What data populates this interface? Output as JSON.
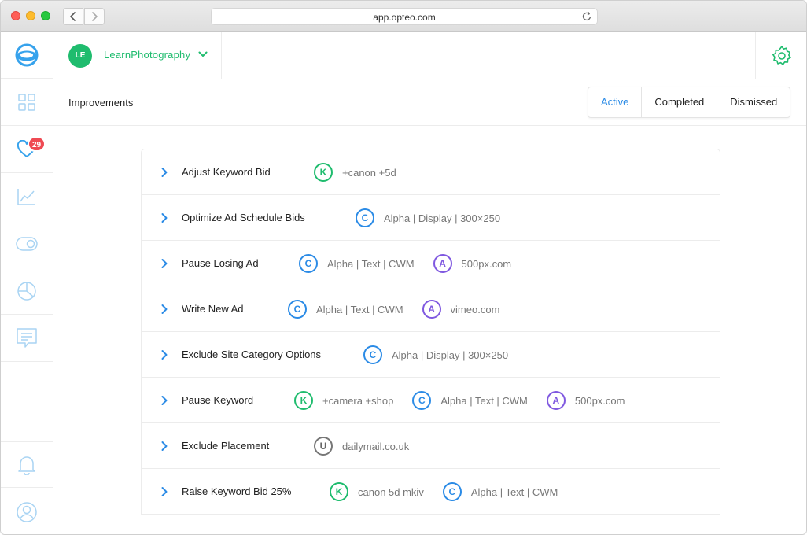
{
  "browser": {
    "url": "app.opteo.com",
    "icons": {
      "back": "chevron-left-icon",
      "forward": "chevron-right-icon",
      "reload": "reload-icon"
    }
  },
  "sidebar": {
    "items": [
      {
        "name": "logo",
        "icon": "opteo-logo-icon"
      },
      {
        "name": "dashboard",
        "icon": "grid-icon"
      },
      {
        "name": "improvements",
        "icon": "heart-icon",
        "badge": "29"
      },
      {
        "name": "performance",
        "icon": "line-chart-icon"
      },
      {
        "name": "toggles",
        "icon": "toggle-icon"
      },
      {
        "name": "reports",
        "icon": "pie-chart-icon"
      },
      {
        "name": "messages",
        "icon": "message-icon"
      }
    ],
    "bottom": [
      {
        "name": "notifications",
        "icon": "bell-icon"
      },
      {
        "name": "profile",
        "icon": "user-icon"
      }
    ]
  },
  "account": {
    "initials": "LE",
    "name": "LearnPhotography"
  },
  "page": {
    "title": "Improvements",
    "tabs": [
      {
        "label": "Active",
        "active": true
      },
      {
        "label": "Completed",
        "active": false
      },
      {
        "label": "Dismissed",
        "active": false
      }
    ]
  },
  "colors": {
    "green": "#1fbc6e",
    "blue": "#2b8be6",
    "purple": "#7f58e0",
    "gray": "#777777",
    "badge": "#ef4a53"
  },
  "improvements": [
    {
      "title": "Adjust Keyword Bid",
      "tags": [
        {
          "letter": "K",
          "type": "green",
          "text": "+canon +5d"
        }
      ]
    },
    {
      "title": "Optimize Ad Schedule Bids",
      "tags": [
        {
          "letter": "C",
          "type": "blue",
          "text": "Alpha | Display | 300×250"
        }
      ]
    },
    {
      "title": "Pause Losing Ad",
      "tags": [
        {
          "letter": "C",
          "type": "blue",
          "text": "Alpha | Text | CWM"
        },
        {
          "letter": "A",
          "type": "purple",
          "text": "500px.com"
        }
      ]
    },
    {
      "title": "Write New Ad",
      "tags": [
        {
          "letter": "C",
          "type": "blue",
          "text": "Alpha | Text | CWM"
        },
        {
          "letter": "A",
          "type": "purple",
          "text": "vimeo.com"
        }
      ]
    },
    {
      "title": "Exclude Site Category Options",
      "tags": [
        {
          "letter": "C",
          "type": "blue",
          "text": "Alpha | Display | 300×250"
        }
      ]
    },
    {
      "title": "Pause Keyword",
      "tags": [
        {
          "letter": "K",
          "type": "green",
          "text": "+camera +shop"
        },
        {
          "letter": "C",
          "type": "blue",
          "text": "Alpha | Text | CWM"
        },
        {
          "letter": "A",
          "type": "purple",
          "text": "500px.com"
        }
      ]
    },
    {
      "title": "Exclude Placement",
      "tags": [
        {
          "letter": "U",
          "type": "gray",
          "text": "dailymail.co.uk"
        }
      ]
    },
    {
      "title": "Raise Keyword Bid 25%",
      "tags": [
        {
          "letter": "K",
          "type": "green",
          "text": "canon 5d mkiv"
        },
        {
          "letter": "C",
          "type": "blue",
          "text": "Alpha | Text | CWM"
        }
      ]
    }
  ]
}
